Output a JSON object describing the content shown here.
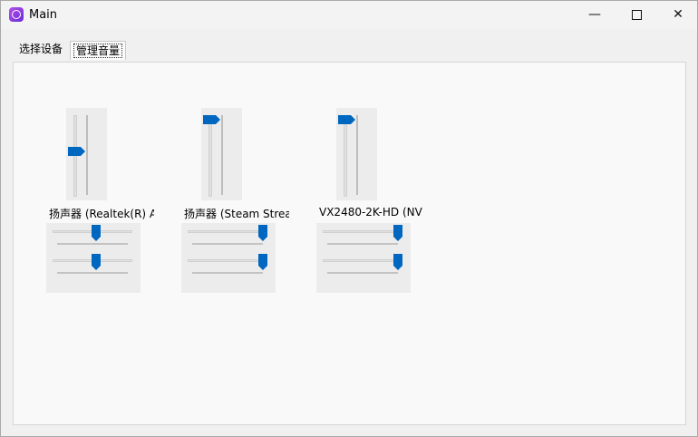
{
  "window": {
    "title": "Main",
    "controls": {
      "minimize": "—",
      "close": "✕"
    }
  },
  "tabs": [
    {
      "label": "选择设备",
      "selected": false
    },
    {
      "label": "管理音量",
      "selected": true
    }
  ],
  "devices": [
    {
      "name": "扬声器 (Realtek(R) A",
      "master_level": 0.55,
      "left_level": 0.55,
      "right_level": 0.55
    },
    {
      "name": "扬声器 (Steam Strea",
      "master_level": 1.0,
      "left_level": 1.0,
      "right_level": 1.0
    },
    {
      "name": "VX2480-2K-HD (NV",
      "master_level": 1.0,
      "left_level": 1.0,
      "right_level": 1.0
    }
  ],
  "colors": {
    "accent": "#0067c0",
    "panel": "#f9f9f9",
    "slider_bg": "#ececec"
  },
  "icons": {
    "app": "audio-app-icon",
    "min": "minimize-icon",
    "max": "maximize-icon",
    "close": "close-icon"
  }
}
